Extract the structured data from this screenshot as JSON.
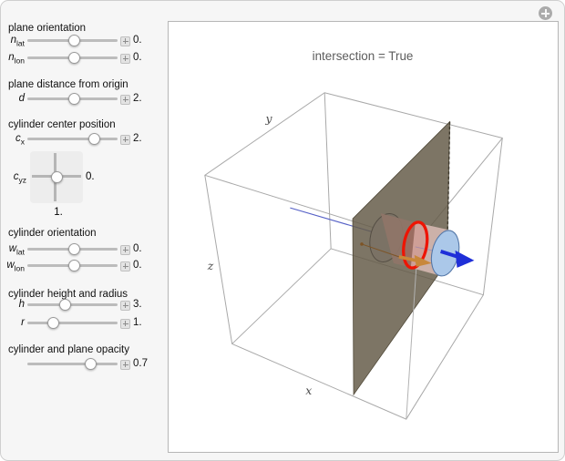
{
  "controls": {
    "groups": [
      {
        "title": "plane orientation",
        "sliders": [
          {
            "label": {
              "base": "n",
              "sub": "lat"
            },
            "value": "0."
          },
          {
            "label": {
              "base": "n",
              "sub": "lon"
            },
            "value": "0."
          }
        ]
      },
      {
        "title": "plane distance from origin",
        "sliders": [
          {
            "label": {
              "base": "d",
              "sub": ""
            },
            "value": "2."
          }
        ]
      },
      {
        "title": "cylinder center position",
        "sliders": [
          {
            "label": {
              "base": "c",
              "sub": "x"
            },
            "value": "2."
          }
        ],
        "pad": {
          "label": {
            "base": "c",
            "sub": "yz"
          },
          "value_right": "0.",
          "value_below": "1."
        }
      },
      {
        "title": "cylinder orientation",
        "sliders": [
          {
            "label": {
              "base": "w",
              "sub": "lat"
            },
            "value": "0."
          },
          {
            "label": {
              "base": "w",
              "sub": "lon"
            },
            "value": "0."
          }
        ]
      },
      {
        "title": "cylinder height and radius",
        "sliders": [
          {
            "label": {
              "base": "h",
              "sub": ""
            },
            "value": "3."
          },
          {
            "label": {
              "base": "r",
              "sub": ""
            },
            "value": "1."
          }
        ]
      },
      {
        "title": "cylinder and plane opacity",
        "sliders": [
          {
            "label": {
              "base": "",
              "sub": ""
            },
            "value": "0.7"
          }
        ]
      }
    ]
  },
  "scene": {
    "status": "intersection = True",
    "axis_labels": {
      "x": "x",
      "y": "y",
      "z": "z"
    },
    "colors": {
      "plane": "#645a48",
      "cylinder_front": "#ccb1a9",
      "cylinder_back": "#8f7568",
      "right_cap": "#abc8e9",
      "intersection_ring": "#ee1404",
      "normal_arrow": "#1f2fd8",
      "axis_arrow": "#c8873a",
      "box_edges": "#a8a8a8"
    }
  }
}
